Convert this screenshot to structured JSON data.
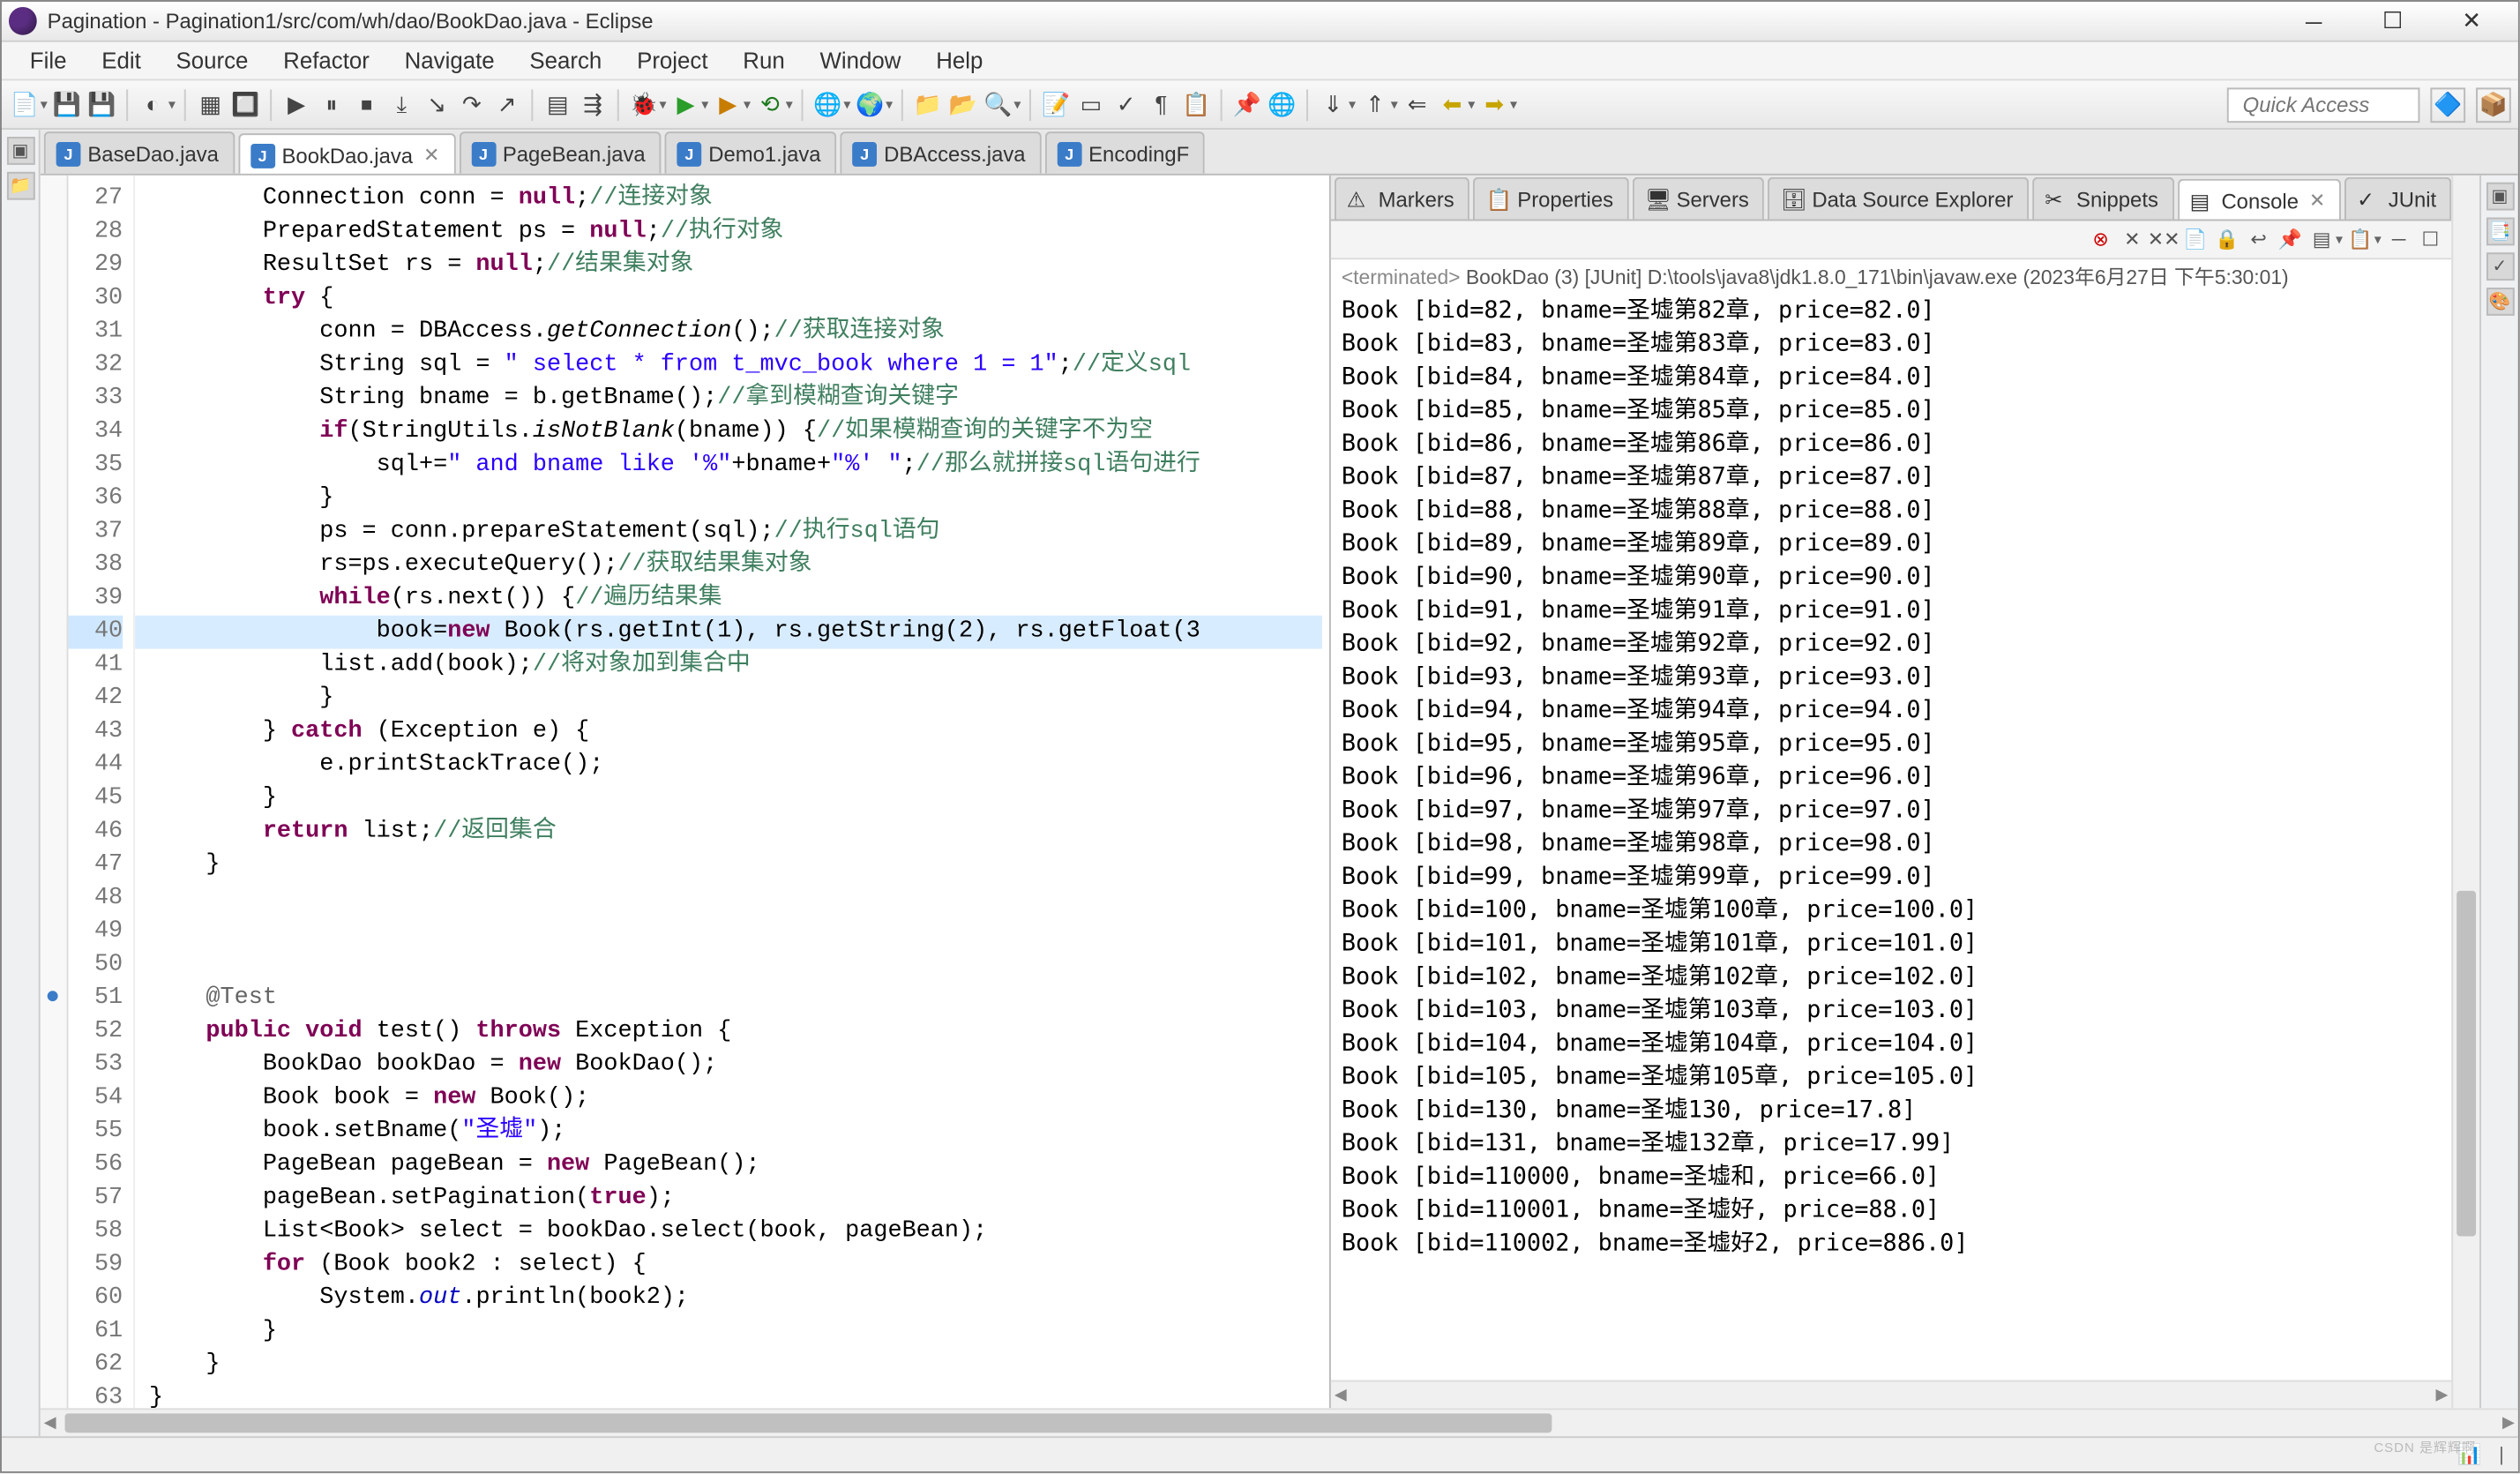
{
  "window_title": "Pagination - Pagination1/src/com/wh/dao/BookDao.java - Eclipse",
  "menubar": [
    "File",
    "Edit",
    "Source",
    "Refactor",
    "Navigate",
    "Search",
    "Project",
    "Run",
    "Window",
    "Help"
  ],
  "quick_access_placeholder": "Quick Access",
  "editor_tabs": [
    {
      "label": "BaseDao.java",
      "active": false,
      "icon": "J"
    },
    {
      "label": "BookDao.java",
      "active": true,
      "icon": "J"
    },
    {
      "label": "PageBean.java",
      "active": false,
      "icon": "J"
    },
    {
      "label": "Demo1.java",
      "active": false,
      "icon": "J"
    },
    {
      "label": "DBAccess.java",
      "active": false,
      "icon": "J"
    },
    {
      "label": "EncodingF",
      "active": false,
      "icon": "J"
    }
  ],
  "right_tabs": [
    {
      "label": "Markers",
      "icon": "markers"
    },
    {
      "label": "Properties",
      "icon": "props"
    },
    {
      "label": "Servers",
      "icon": "servers"
    },
    {
      "label": "Data Source Explorer",
      "icon": "dse"
    },
    {
      "label": "Snippets",
      "icon": "snip"
    },
    {
      "label": "Console",
      "icon": "console",
      "active": true
    },
    {
      "label": "JUnit",
      "icon": "junit"
    }
  ],
  "line_start": 27,
  "line_end": 63,
  "highlight_line": 40,
  "code_lines": [
    {
      "n": 27,
      "html": "        Connection conn = <span class='kw'>null</span>;<span class='cmt'>//连接对象</span>"
    },
    {
      "n": 28,
      "html": "        PreparedStatement ps = <span class='kw'>null</span>;<span class='cmt'>//执行对象</span>"
    },
    {
      "n": 29,
      "html": "        ResultSet rs = <span class='kw'>null</span>;<span class='cmt'>//结果集对象</span>"
    },
    {
      "n": 30,
      "html": "        <span class='kw'>try</span> {"
    },
    {
      "n": 31,
      "html": "            conn = DBAccess.<span class='mth'>getConnection</span>();<span class='cmt'>//获取连接对象</span>"
    },
    {
      "n": 32,
      "html": "            String sql = <span class='str'>\" select * from t_mvc_book where 1 = 1\"</span>;<span class='cmt'>//定义sql</span>"
    },
    {
      "n": 33,
      "html": "            String bname = b.getBname();<span class='cmt'>//拿到模糊查询关键字</span>"
    },
    {
      "n": 34,
      "html": "            <span class='kw'>if</span>(StringUtils.<span class='mth'>isNotBlank</span>(bname)) {<span class='cmt'>//如果模糊查询的关键字不为空</span>"
    },
    {
      "n": 35,
      "html": "                sql+=<span class='str'>\" and bname like '%\"</span>+bname+<span class='str'>\"%' \"</span>;<span class='cmt'>//那么就拼接sql语句进行</span>"
    },
    {
      "n": 36,
      "html": "            }"
    },
    {
      "n": 37,
      "html": "            ps = conn.prepareStatement(sql);<span class='cmt'>//执行sql语句</span>"
    },
    {
      "n": 38,
      "html": "            rs=ps.executeQuery();<span class='cmt'>//获取结果集对象</span>"
    },
    {
      "n": 39,
      "html": "            <span class='kw'>while</span>(rs.next()) {<span class='cmt'>//遍历结果集</span>"
    },
    {
      "n": 40,
      "html": "                book=<span class='kw'>new</span> Book(rs.getInt(1), rs.getString(2), rs.getFloat(3"
    },
    {
      "n": 41,
      "html": "            list.add(book);<span class='cmt'>//将对象加到集合中</span>"
    },
    {
      "n": 42,
      "html": "            }"
    },
    {
      "n": 43,
      "html": "        } <span class='kw'>catch</span> (Exception e) {"
    },
    {
      "n": 44,
      "html": "            e.printStackTrace();"
    },
    {
      "n": 45,
      "html": "        }"
    },
    {
      "n": 46,
      "html": "        <span class='kw'>return</span> list;<span class='cmt'>//返回集合</span>"
    },
    {
      "n": 47,
      "html": "    }"
    },
    {
      "n": 48,
      "html": ""
    },
    {
      "n": 49,
      "html": ""
    },
    {
      "n": 50,
      "html": ""
    },
    {
      "n": 51,
      "html": "    <span class='ann'>@Test</span>"
    },
    {
      "n": 52,
      "html": "    <span class='kw'>public</span> <span class='kw'>void</span> test() <span class='kw'>throws</span> Exception {"
    },
    {
      "n": 53,
      "html": "        BookDao bookDao = <span class='kw'>new</span> BookDao();"
    },
    {
      "n": 54,
      "html": "        Book book = <span class='kw'>new</span> Book();"
    },
    {
      "n": 55,
      "html": "        book.setBname(<span class='str'>\"圣墟\"</span>);"
    },
    {
      "n": 56,
      "html": "        PageBean pageBean = <span class='kw'>new</span> PageBean();"
    },
    {
      "n": 57,
      "html": "        pageBean.setPagination(<span class='kw'>true</span>);"
    },
    {
      "n": 58,
      "html": "        List&lt;Book&gt; select = bookDao.select(book, pageBean);"
    },
    {
      "n": 59,
      "html": "        <span class='kw'>for</span> (Book book2 : select) {"
    },
    {
      "n": 60,
      "html": "            System.<span class='fld'><i>out</i></span>.println(book2);"
    },
    {
      "n": 61,
      "html": "        }"
    },
    {
      "n": 62,
      "html": "    }"
    },
    {
      "n": 63,
      "html": "}"
    }
  ],
  "console_header_prefix": "<terminated>",
  "console_header_main": " BookDao (3) [JUnit] D:\\tools\\java8\\jdk1.8.0_171\\bin\\javaw.exe (2023年6月27日 下午5:30:01)",
  "console_lines": [
    "Book [bid=82, bname=圣墟第82章, price=82.0]",
    "Book [bid=83, bname=圣墟第83章, price=83.0]",
    "Book [bid=84, bname=圣墟第84章, price=84.0]",
    "Book [bid=85, bname=圣墟第85章, price=85.0]",
    "Book [bid=86, bname=圣墟第86章, price=86.0]",
    "Book [bid=87, bname=圣墟第87章, price=87.0]",
    "Book [bid=88, bname=圣墟第88章, price=88.0]",
    "Book [bid=89, bname=圣墟第89章, price=89.0]",
    "Book [bid=90, bname=圣墟第90章, price=90.0]",
    "Book [bid=91, bname=圣墟第91章, price=91.0]",
    "Book [bid=92, bname=圣墟第92章, price=92.0]",
    "Book [bid=93, bname=圣墟第93章, price=93.0]",
    "Book [bid=94, bname=圣墟第94章, price=94.0]",
    "Book [bid=95, bname=圣墟第95章, price=95.0]",
    "Book [bid=96, bname=圣墟第96章, price=96.0]",
    "Book [bid=97, bname=圣墟第97章, price=97.0]",
    "Book [bid=98, bname=圣墟第98章, price=98.0]",
    "Book [bid=99, bname=圣墟第99章, price=99.0]",
    "Book [bid=100, bname=圣墟第100章, price=100.0]",
    "Book [bid=101, bname=圣墟第101章, price=101.0]",
    "Book [bid=102, bname=圣墟第102章, price=102.0]",
    "Book [bid=103, bname=圣墟第103章, price=103.0]",
    "Book [bid=104, bname=圣墟第104章, price=104.0]",
    "Book [bid=105, bname=圣墟第105章, price=105.0]",
    "Book [bid=130, bname=圣墟130, price=17.8]",
    "Book [bid=131, bname=圣墟132章, price=17.99]",
    "Book [bid=110000, bname=圣墟和, price=66.0]",
    "Book [bid=110001, bname=圣墟好, price=88.0]",
    "Book [bid=110002, bname=圣墟好2, price=886.0]"
  ],
  "watermark": "CSDN 是辉辉啊"
}
